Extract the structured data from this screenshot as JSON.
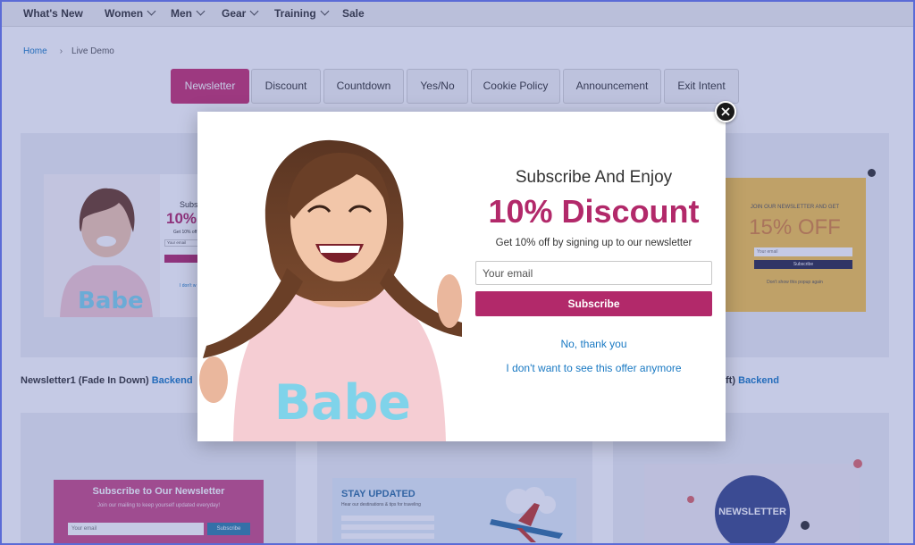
{
  "nav": {
    "items": [
      {
        "label": "What's New",
        "has_menu": false
      },
      {
        "label": "Women",
        "has_menu": true
      },
      {
        "label": "Men",
        "has_menu": true
      },
      {
        "label": "Gear",
        "has_menu": true
      },
      {
        "label": "Training",
        "has_menu": true
      },
      {
        "label": "Sale",
        "has_menu": false
      }
    ]
  },
  "breadcrumb": {
    "home": "Home",
    "current": "Live Demo"
  },
  "tabs": [
    {
      "label": "Newsletter",
      "active": true
    },
    {
      "label": "Discount",
      "active": false
    },
    {
      "label": "Countdown",
      "active": false
    },
    {
      "label": "Yes/No",
      "active": false
    },
    {
      "label": "Cookie Policy",
      "active": false
    },
    {
      "label": "Announcement",
      "active": false
    },
    {
      "label": "Exit Intent",
      "active": false
    }
  ],
  "demos": {
    "left_caption_text": "Newsletter1 (Fade In Down)",
    "left_caption_link": "Backend",
    "right_caption_text": "ft)",
    "right_caption_link": "Backend",
    "thumb1_sub": "Subs",
    "thumb1_discount": "10%",
    "thumb1_line": "Get 10% off",
    "thumb1_field": "Your email",
    "thumb1_link": "I don't w",
    "thumb3_heading": "JOIN OUR NEWSLETTER AND GET",
    "thumb3_discount": "15% OFF",
    "thumb3_field": "Your email",
    "thumb3_button": "Subscribe",
    "thumb3_link": "Don't show this popup again",
    "card1_title": "Subscribe to Our Newsletter",
    "card1_text": "Join our mailing to keep yourself updated everyday!",
    "card1_field": "Your email",
    "card1_button": "Subscribe",
    "card2_title": "STAY UPDATED",
    "card2_text": "Hear our destinations & tips for traveling",
    "card3_title": "NEWSLETTER"
  },
  "modal": {
    "heading": "Subscribe And Enjoy",
    "discount": "10% Discount",
    "subtext": "Get 10% off by signing up to our newsletter",
    "email_placeholder": "Your email",
    "subscribe_label": "Subscribe",
    "no_thanks": "No, thank you",
    "dont_show": "I don't want to see this offer anymore",
    "shirt_text": "Babe"
  },
  "colors": {
    "accent": "#b2296a",
    "link": "#1979c3",
    "overlay": "#4050aa"
  }
}
